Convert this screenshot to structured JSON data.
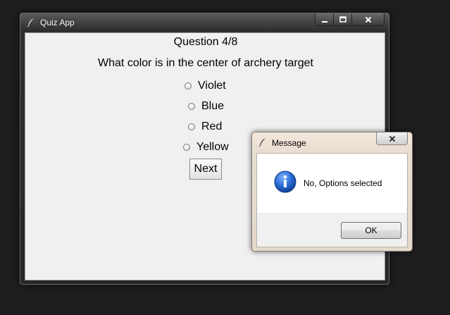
{
  "window": {
    "title": "Quiz App",
    "icon": "feather-icon"
  },
  "quiz": {
    "question_number": "Question 4/8",
    "question_text": "What color is in the center of archery target",
    "options": [
      "Violet",
      "Blue",
      "Red",
      "Yellow"
    ],
    "selected_option": null,
    "next_label": "Next"
  },
  "dialog": {
    "title": "Message",
    "icon": "info-icon",
    "message": "No, Options selected",
    "ok_label": "OK"
  },
  "colors": {
    "desktop": "#1e1e1e",
    "client_bg": "#f0f0f0",
    "info_blue": "#1f5fbf"
  }
}
